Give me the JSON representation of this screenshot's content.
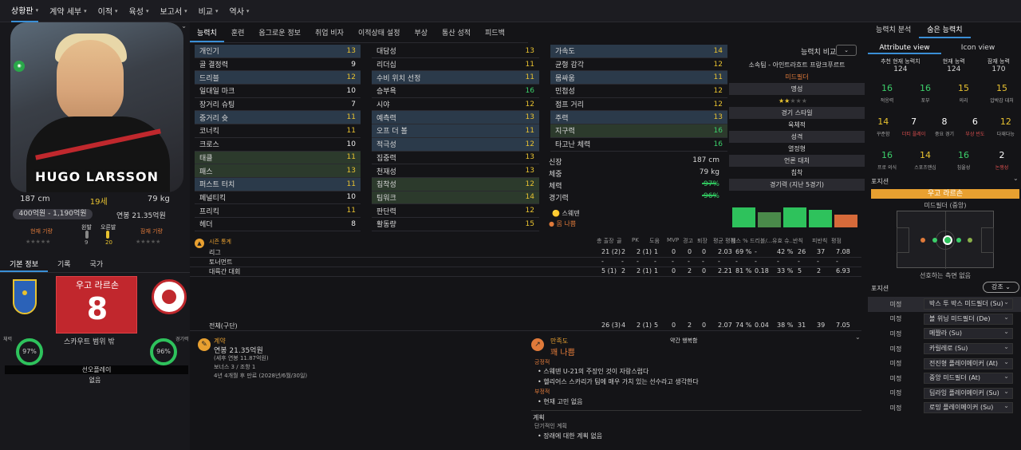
{
  "nav": [
    {
      "label": "상황판",
      "active": true
    },
    {
      "label": "계약 세부"
    },
    {
      "label": "이적"
    },
    {
      "label": "육성"
    },
    {
      "label": "보고서"
    },
    {
      "label": "비교"
    },
    {
      "label": "역사"
    }
  ],
  "player": {
    "name": "HUGO LARSSON",
    "kr_name": "우고 라르손",
    "height": "187 cm",
    "age": "19세",
    "weight": "79 kg",
    "value": "400억원 - 1,190억원",
    "salary": "연봉 21.35억원",
    "number": "8",
    "scout_range": "스카우트 범위 밖",
    "fitness": "97%",
    "sharpness": "96%",
    "fitness_lbl": "체력",
    "sharpness_lbl": "경기력",
    "set_piece_lbl": "선오플레이",
    "set_piece_val": "없음"
  },
  "potential": {
    "current": "현재 기량",
    "potential": "잠재 기량"
  },
  "foot": {
    "left": "왼발",
    "right": "오른발",
    "left_val": "9",
    "right_val": "20"
  },
  "left_tabs": [
    "기본 정보",
    "기록",
    "국가"
  ],
  "main_tabs": [
    "능력치",
    "훈련",
    "옵그로운 정보",
    "취업 비자",
    "이적상태 설정",
    "부상",
    "통산 성적",
    "피드백"
  ],
  "attrs_col1": [
    [
      "개인기",
      "13",
      "y",
      "hl"
    ],
    [
      "골 결정력",
      "9",
      "w",
      ""
    ],
    [
      "드리블",
      "12",
      "y",
      "hl"
    ],
    [
      "일대일 마크",
      "10",
      "w",
      ""
    ],
    [
      "장거리 슈팅",
      "7",
      "w",
      ""
    ],
    [
      "중거리 슛",
      "11",
      "y",
      "hl"
    ],
    [
      "코너킥",
      "11",
      "y",
      ""
    ],
    [
      "크로스",
      "10",
      "w",
      ""
    ],
    [
      "태클",
      "11",
      "y",
      "gr"
    ],
    [
      "패스",
      "13",
      "y",
      "gr"
    ],
    [
      "퍼스트 터치",
      "11",
      "y",
      "hl"
    ],
    [
      "페널티킥",
      "10",
      "w",
      ""
    ],
    [
      "프리킥",
      "11",
      "y",
      ""
    ],
    [
      "헤더",
      "8",
      "w",
      ""
    ]
  ],
  "attrs_col2": [
    [
      "대담성",
      "13",
      "y",
      ""
    ],
    [
      "리더십",
      "11",
      "y",
      ""
    ],
    [
      "수비 위치 선정",
      "11",
      "y",
      "hl"
    ],
    [
      "승부욕",
      "16",
      "g",
      ""
    ],
    [
      "시야",
      "12",
      "y",
      ""
    ],
    [
      "예측력",
      "13",
      "y",
      "hl"
    ],
    [
      "오프 더 볼",
      "11",
      "y",
      "hl"
    ],
    [
      "적극성",
      "12",
      "y",
      "hl"
    ],
    [
      "집중력",
      "13",
      "y",
      ""
    ],
    [
      "천재성",
      "13",
      "y",
      ""
    ],
    [
      "침착성",
      "12",
      "y",
      "gr"
    ],
    [
      "팀워크",
      "14",
      "y",
      "gr"
    ],
    [
      "판단력",
      "12",
      "y",
      ""
    ],
    [
      "활동량",
      "15",
      "y",
      ""
    ]
  ],
  "attrs_col3": [
    [
      "가속도",
      "14",
      "y",
      "hl"
    ],
    [
      "균형 감각",
      "12",
      "y",
      ""
    ],
    [
      "몸싸움",
      "11",
      "y",
      "hl"
    ],
    [
      "민첩성",
      "12",
      "y",
      ""
    ],
    [
      "점프 거리",
      "12",
      "y",
      ""
    ],
    [
      "주력",
      "13",
      "y",
      "hl"
    ],
    [
      "지구력",
      "16",
      "g",
      "gr"
    ],
    [
      "타고난 체력",
      "16",
      "g",
      ""
    ]
  ],
  "phys": [
    [
      "신장",
      "187 cm"
    ],
    [
      "체중",
      "79 kg"
    ],
    [
      "체력",
      "97%"
    ],
    [
      "경기력",
      "96%"
    ]
  ],
  "nation": "스웨덴",
  "injury": "몸 나쁨",
  "compare": "능력치 비교",
  "info": {
    "club": "소속팀 - 아인트라흐트 프랑크푸르트",
    "position": "미드필더",
    "rep": "명성",
    "style_h": "경기 스타일",
    "style": "육체적",
    "person_h": "성격",
    "person": "열정형",
    "media_h": "언론 대처",
    "media": "침착",
    "form_h": "경기력 (지난 5경기)"
  },
  "form": [
    {
      "v": 0.85,
      "c": "#2ec25c"
    },
    {
      "v": 0.65,
      "c": "#4a8a4a"
    },
    {
      "v": 0.85,
      "c": "#2ec25c"
    },
    {
      "v": 0.75,
      "c": "#2ec25c"
    },
    {
      "v": 0.55,
      "c": "#d66a3a"
    }
  ],
  "stats": {
    "title": "시즌 통계",
    "cols": [
      "총 출장",
      "골",
      "PK",
      "도움",
      "MVP",
      "경고",
      "퇴장",
      "평균 평점",
      "패스 %",
      "드리블/...",
      "유효 슈...",
      "반칙",
      "피반칙",
      "평점"
    ],
    "rows": [
      [
        "리그",
        "21 (2)",
        "2",
        "2 (1)",
        "1",
        "0",
        "0",
        "0",
        "2.03",
        "69 %",
        "-",
        "42 %",
        "26",
        "37",
        "7.08"
      ],
      [
        "토너먼트",
        "-",
        "-",
        "-",
        "-",
        "-",
        "-",
        "-",
        "-",
        "-",
        "-",
        "-",
        "-",
        "-",
        "-"
      ],
      [
        "대륙간 대회",
        "5 (1)",
        "2",
        "2 (1)",
        "1",
        "0",
        "2",
        "0",
        "2.21",
        "81 %",
        "0.18",
        "33 %",
        "5",
        "2",
        "6.93"
      ]
    ],
    "total": [
      "전체(구단)",
      "26 (3)",
      "4",
      "2 (1)",
      "5",
      "0",
      "2",
      "0",
      "2.07",
      "74 %",
      "0.04",
      "38 %",
      "31",
      "39",
      "7.05"
    ]
  },
  "contract": {
    "title": "계약",
    "wage": "연봉 21.35억원",
    "sub": "(세후 연봉 11.87억원)",
    "bonus": "보너스 3 / 조항 1",
    "expiry": "4년 4개월 후 만료 (2028년/6월/30일)"
  },
  "happy": {
    "title": "만족도",
    "status": "약간 행복함",
    "val": "꽤 나쁨",
    "pos_h": "긍정적",
    "pos": [
      "스웨덴 U-21의 주장인 것이 자랑스럽다",
      "헬리어스 스카리가 팀에 매우 가치 있는 선수라고 생각한다"
    ],
    "neg_h": "부정적",
    "neg": [
      "현재 고민 없음"
    ],
    "plan_h": "계획",
    "plan_sub": "단기적인 계획",
    "plan": [
      "장래에 대한 계획 없음"
    ]
  },
  "right_tabs": [
    "능력치 분석",
    "숨은 능력치"
  ],
  "right_tabs2": [
    "Attribute view",
    "Icon view"
  ],
  "abil": [
    [
      "추천 현재 능력치",
      "124"
    ],
    [
      "현재 능력",
      "124"
    ],
    [
      "잠재 능력",
      "170"
    ]
  ],
  "hidden1": [
    [
      "16",
      "적응력",
      "#3ccf6a"
    ],
    [
      "16",
      "포부",
      "#3ccf6a"
    ],
    [
      "15",
      "의리",
      "#e8c230"
    ],
    [
      "15",
      "압박감 대처",
      "#e8c230"
    ]
  ],
  "hidden2": [
    [
      "14",
      "꾸준함",
      "#e8c230"
    ],
    [
      "7",
      "더티 플레이",
      "#fff"
    ],
    [
      "8",
      "중요 경기",
      "#fff"
    ],
    [
      "6",
      "부상 빈도",
      "#fff"
    ],
    [
      "12",
      "다재다능",
      "#e8c230"
    ]
  ],
  "hidden3": [
    [
      "16",
      "프로 의식",
      "#3ccf6a"
    ],
    [
      "14",
      "스포츠맨십",
      "#e8c230"
    ],
    [
      "16",
      "침울성",
      "#3ccf6a"
    ],
    [
      "2",
      "논쟁성",
      "#fff"
    ]
  ],
  "hidden2_lblcol": [
    "#aaa",
    "#e05050",
    "#aaa",
    "#e05050",
    "#aaa"
  ],
  "hidden3_lblcol": [
    "#aaa",
    "#aaa",
    "#aaa",
    "#e05050"
  ],
  "position": {
    "h": "포지션",
    "name": "우고 라르손",
    "role": "미드필더 (중앙)",
    "note": "선호하는 측면 없음",
    "roles_h": "포지션",
    "strength": "강조"
  },
  "roles": [
    [
      "미정",
      "박스 투 박스 미드필더 (Su)"
    ],
    [
      "미정",
      "볼 위닝 미드필더 (De)"
    ],
    [
      "미정",
      "메짤라 (Su)"
    ],
    [
      "미정",
      "카릴레로 (Su)"
    ],
    [
      "미정",
      "전진형 플레이메이커 (At)"
    ],
    [
      "미정",
      "중앙 미드필더 (At)"
    ],
    [
      "미정",
      "딥라잉 플레이메이커 (Su)"
    ],
    [
      "미정",
      "로밍 플레이메이커 (Su)"
    ]
  ]
}
